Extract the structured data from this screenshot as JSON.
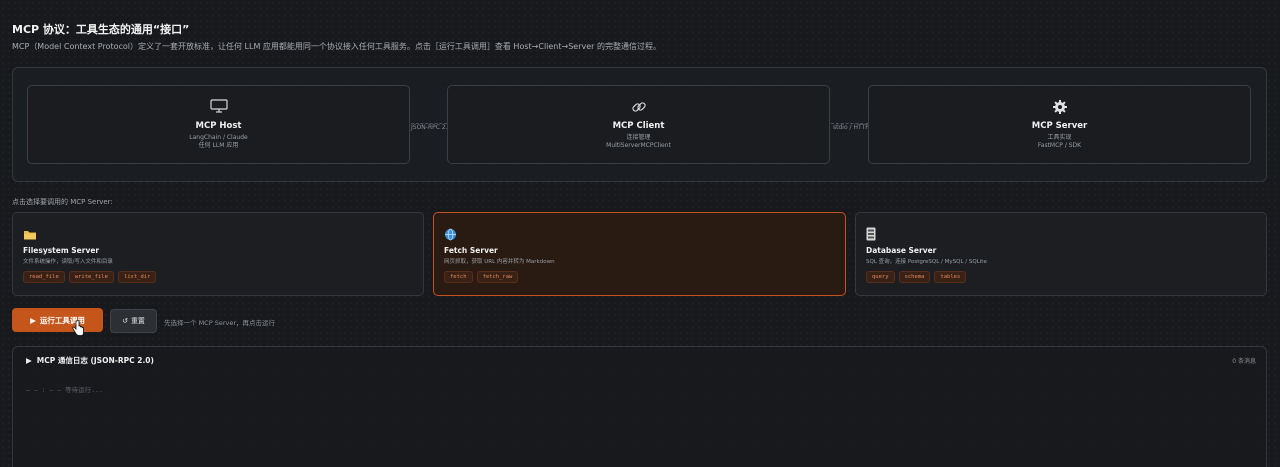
{
  "page": {
    "title": "MCP 协议：工具生态的通用“接口”",
    "subtitle": "MCP（Model Context Protocol）定义了一套开放标准，让任何 LLM 应用都能用同一个协议接入任何工具服务。点击［运行工具调用］查看 Host→Client→Server 的完整通信过程。"
  },
  "architecture": {
    "nodes": [
      {
        "name": "MCP Host",
        "desc1": "LangChain / Claude",
        "desc2": "任何 LLM 应用",
        "icon": "monitor-icon"
      },
      {
        "name": "MCP Client",
        "desc1": "连接管理",
        "desc2": "MultiServerMCPClient",
        "icon": "link-icon"
      },
      {
        "name": "MCP Server",
        "desc1": "工具实现",
        "desc2": "FastMCP / SDK",
        "icon": "gear-icon"
      }
    ],
    "connectors": [
      "JSON-RPC 2.0",
      "stdio / HTTP"
    ]
  },
  "server_picker": {
    "label": "点击选择要调用的 MCP Server:",
    "servers": [
      {
        "name": "Filesystem Server",
        "desc": "文件系统操作，读取/写入文件和目录",
        "tags": [
          "read_file",
          "write_file",
          "list_dir"
        ],
        "icon": "folder-icon",
        "selected": false
      },
      {
        "name": "Fetch Server",
        "desc": "网页抓取，获取 URL 内容并转为 Markdown",
        "tags": [
          "fetch",
          "fetch_raw"
        ],
        "icon": "globe-icon",
        "selected": true
      },
      {
        "name": "Database Server",
        "desc": "SQL 查询，连接 PostgreSQL / MySQL / SQLite",
        "tags": [
          "query",
          "schema",
          "tables"
        ],
        "icon": "database-icon",
        "selected": false
      }
    ]
  },
  "actions": {
    "run_label": "运行工具调用",
    "reset_label": "重置",
    "hint": "先选择一个 MCP Server，再点击运行"
  },
  "log": {
    "title": "MCP 通信日志 (JSON-RPC 2.0)",
    "count": "0 条消息",
    "empty": "— — : — — 等待运行..."
  },
  "colors": {
    "accent": "#c4561b",
    "selected_border": "#c2531f"
  }
}
